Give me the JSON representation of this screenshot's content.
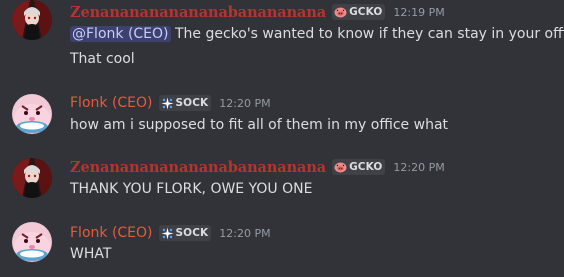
{
  "messages": [
    {
      "author": "Zenananananananabanananana",
      "tag": "GCKO",
      "time": "12:19 PM",
      "lines": [
        {
          "mention": "@Flonk (CEO)",
          "text": " The gecko's wanted to know if they can stay in your office"
        },
        {
          "text": "That cool"
        }
      ]
    },
    {
      "author": "Flonk (CEO)",
      "tag": "SOCK",
      "time": "12:20 PM",
      "lines": [
        {
          "text": "how am i supposed to fit all of them in my office what"
        }
      ]
    },
    {
      "author": "Zenananananananabanananana",
      "tag": "GCKO",
      "time": "12:20 PM",
      "lines": [
        {
          "text": "THANK YOU FLORK, OWE YOU ONE"
        }
      ]
    },
    {
      "author": "Flonk (CEO)",
      "tag": "SOCK",
      "time": "12:20 PM",
      "lines": [
        {
          "text": "WHAT"
        }
      ]
    }
  ],
  "colors": {
    "background": "#313338",
    "zen_name": "#b5342e",
    "flonk_name": "#e55b3a",
    "mention_bg": "#3c4270",
    "text": "#dbdee1",
    "timestamp": "#949ba4"
  },
  "icons": {
    "gcko_tag": "pig-face-icon",
    "sock_tag": "sparkle-icon"
  }
}
